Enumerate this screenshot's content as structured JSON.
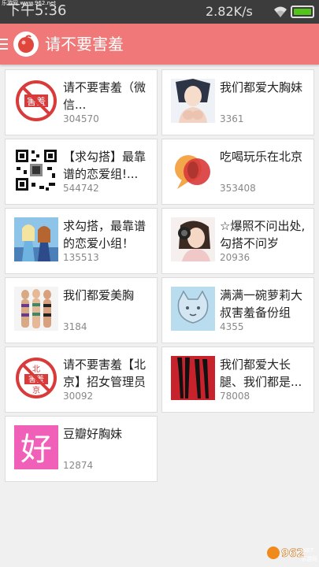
{
  "statusbar": {
    "watermark": "乐游网 www.962.net",
    "time": "下午5:36",
    "net_speed": "2.82K/s"
  },
  "appbar": {
    "title": "请不要害羞",
    "menu_icon": "hamburger-icon",
    "logo_icon": "app-logo-icon"
  },
  "groups": [
    {
      "title": "请不要害羞（微信...",
      "count": "304570",
      "thumb": "no-shy-logo"
    },
    {
      "title": "我们都爱大胸妹",
      "count": "3361",
      "thumb": "anime-girl"
    },
    {
      "title": "【求勾搭】最靠谱的恋爱组!...",
      "count": "544742",
      "thumb": "qr-code"
    },
    {
      "title": "吃喝玩乐在北京",
      "count": "353408",
      "thumb": "speech-bubbles"
    },
    {
      "title": "求勾搭，最靠谱的恋爱小组！",
      "count": "135513",
      "thumb": "frozen-sisters"
    },
    {
      "title": "☆爆照不问出处,勾搭不问岁",
      "count": "20936",
      "thumb": "girl-camera"
    },
    {
      "title": "我们都爱美胸",
      "count": "3184",
      "thumb": "bikini-women"
    },
    {
      "title": "满满一碗萝莉大叔害羞备份组",
      "count": "4355",
      "thumb": "cat-drawing"
    },
    {
      "title": "请不要害羞【北京】招女管理员",
      "count": "30092",
      "thumb": "beijing-no-shy-logo"
    },
    {
      "title": "我们都爱大长腿、我们都是...",
      "count": "78008",
      "thumb": "legs-silhouette"
    },
    {
      "title": "豆瓣好胸妹",
      "count": "12874",
      "thumb": "hao-character"
    }
  ],
  "footer": {
    "brand": "962",
    "brand_suffix": ".NET",
    "sub": "乐游网"
  },
  "colors": {
    "appbar": "#f07878",
    "accent_red": "#d93a3a",
    "pink": "#f060b8"
  }
}
